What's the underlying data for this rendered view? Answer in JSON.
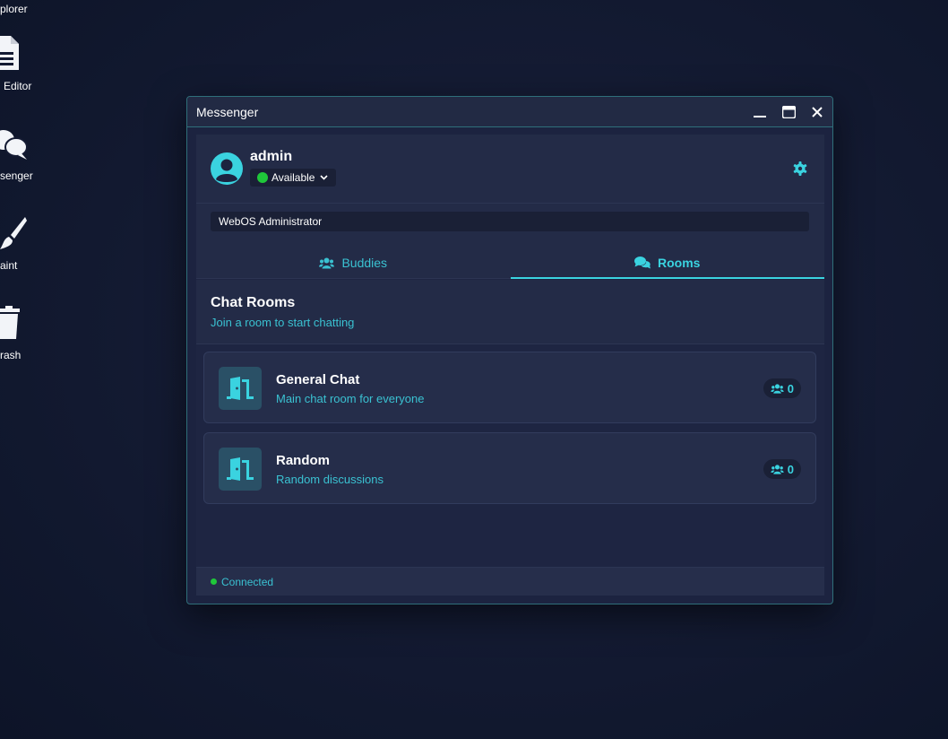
{
  "desktop": {
    "icons": [
      {
        "label": "plorer",
        "icon": "folder-icon"
      },
      {
        "label": "Editor",
        "icon": "document-icon"
      },
      {
        "label": "senger",
        "icon": "chat-icon"
      },
      {
        "label": "aint",
        "icon": "paintbrush-icon"
      },
      {
        "label": "rash",
        "icon": "trash-icon"
      }
    ]
  },
  "window": {
    "title": "Messenger",
    "controls": {
      "minimize": "minimize-icon",
      "maximize": "maximize-icon",
      "close": "close-icon"
    }
  },
  "profile": {
    "username": "admin",
    "status": "Available",
    "status_color": "#1fc73a",
    "status_message": "WebOS Administrator"
  },
  "tabs": [
    {
      "label": "Buddies",
      "icon": "users-icon",
      "active": false
    },
    {
      "label": "Rooms",
      "icon": "comments-icon",
      "active": true
    }
  ],
  "rooms_section": {
    "title": "Chat Rooms",
    "subtitle": "Join a room to start chatting",
    "rooms": [
      {
        "name": "General Chat",
        "description": "Main chat room for everyone",
        "count": "0",
        "icon": "door-open-icon"
      },
      {
        "name": "Random",
        "description": "Random discussions",
        "count": "0",
        "icon": "door-open-icon"
      }
    ]
  },
  "footer": {
    "connection": "Connected",
    "connection_color": "#1fc73a"
  },
  "colors": {
    "accent": "#3ad3e0",
    "accent_text": "#3ac2d2",
    "window_bg": "#1c2340",
    "panel_bg": "#232b47"
  }
}
